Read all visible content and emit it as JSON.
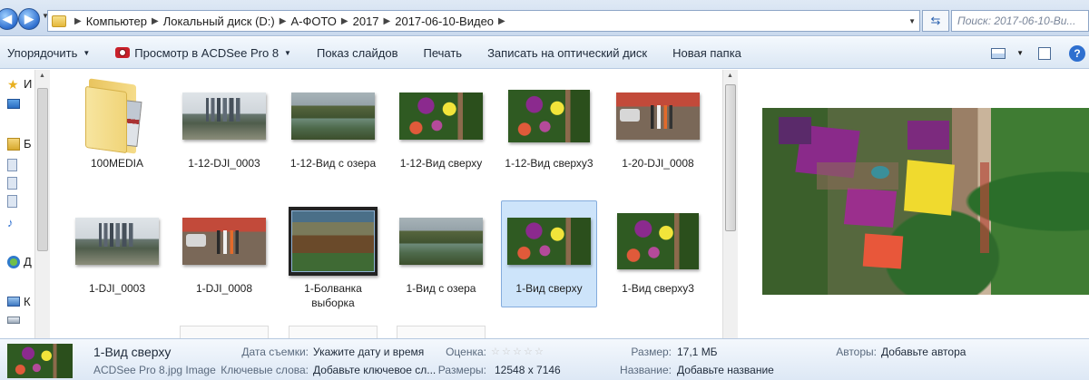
{
  "addressbar": {
    "breadcrumbs": [
      "Компьютер",
      "Локальный диск (D:)",
      "А-ФОТО",
      "2017",
      "2017-06-10-Видео"
    ],
    "search_placeholder": "Поиск: 2017-06-10-Ви..."
  },
  "toolbar": {
    "organize": "Упорядочить",
    "acdsee": "Просмотр в ACDSee Pro 8",
    "slideshow": "Показ слайдов",
    "print": "Печать",
    "burn": "Записать на оптический диск",
    "new_folder": "Новая папка"
  },
  "navpane": {
    "items": [
      "И",
      "Б",
      "Д",
      "К"
    ]
  },
  "files": [
    {
      "name": "100MEDIA",
      "type": "folder"
    },
    {
      "name": "1-12-DJI_0003",
      "type": "city"
    },
    {
      "name": "1-12-Вид с озера",
      "type": "lake"
    },
    {
      "name": "1-12-Вид сверху",
      "type": "houses"
    },
    {
      "name": "1-12-Вид сверху3",
      "type": "houses"
    },
    {
      "name": "1-20-DJI_0008",
      "type": "people"
    },
    {
      "name": "1-DJI_0003",
      "type": "city"
    },
    {
      "name": "1-DJI_0008",
      "type": "people"
    },
    {
      "name": "1-Болванка выборка",
      "type": "screen"
    },
    {
      "name": "1-Вид с озера",
      "type": "lake"
    },
    {
      "name": "1-Вид сверху",
      "type": "houses",
      "selected": true
    },
    {
      "name": "1-Вид сверху3",
      "type": "houses"
    }
  ],
  "details": {
    "filename": "1-Вид сверху",
    "filetype": "ACDSee Pro 8.jpg Image",
    "date_label": "Дата съемки:",
    "date_value": "Укажите дату и время",
    "keywords_label": "Ключевые слова:",
    "keywords_value": "Добавьте ключевое сл...",
    "rating_label": "Оценка:",
    "rating_value": 0,
    "dimensions_label": "Размеры:",
    "dimensions_value": "12548 x 7146",
    "size_label": "Размер:",
    "size_value": "17,1 МБ",
    "title_label": "Название:",
    "title_value": "Добавьте название",
    "authors_label": "Авторы:",
    "authors_value": "Добавьте автора"
  },
  "colors": {
    "selection_bg": "#cde4fa",
    "selection_border": "#84acdd",
    "toolbar_bg": "#dbe7f4"
  }
}
